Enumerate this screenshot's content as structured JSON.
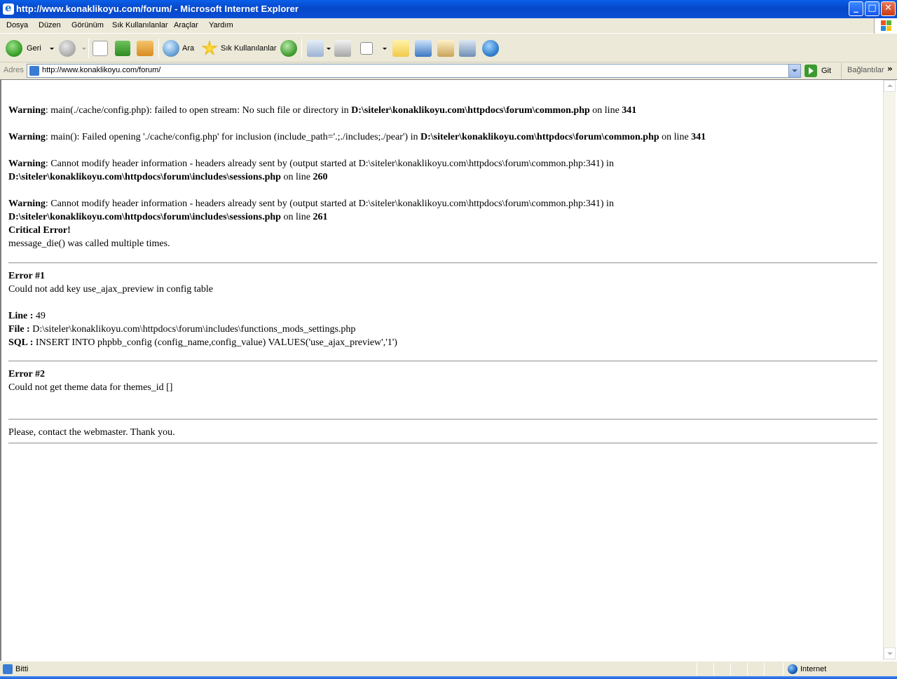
{
  "window": {
    "title": "http://www.konaklikoyu.com/forum/ - Microsoft Internet Explorer",
    "min_label": "_",
    "max_label": "□",
    "close_label": "✕"
  },
  "menu": {
    "items": [
      {
        "label": "Dosya"
      },
      {
        "label": "Düzen"
      },
      {
        "label": "Görünüm"
      },
      {
        "label": "Sık Kullanılanlar"
      },
      {
        "label": "Araçlar"
      },
      {
        "label": "Yardım"
      }
    ]
  },
  "toolbar": {
    "back_label": "Geri",
    "search_label": "Ara",
    "favorites_label": "Sık Kullanılanlar"
  },
  "address": {
    "label": "Adres",
    "url": "http://www.konaklikoyu.com/forum/",
    "go_label": "Git",
    "links_label": "Bağlantılar",
    "links_chevron": "»"
  },
  "page": {
    "warnings": [
      {
        "label": "Warning",
        "text": ": main(./cache/config.php): failed to open stream: No such file or directory in ",
        "path": "D:\\siteler\\konaklikoyu.com\\httpdocs\\forum\\common.php",
        "online": " on line ",
        "line": "341"
      },
      {
        "label": "Warning",
        "text": ": main(): Failed opening './cache/config.php' for inclusion (include_path='.;./includes;./pear') in ",
        "path": "D:\\siteler\\konaklikoyu.com\\httpdocs\\forum\\common.php",
        "online": " on line ",
        "line": "341"
      },
      {
        "label": "Warning",
        "text": ": Cannot modify header information - headers already sent by (output started at D:\\siteler\\konaklikoyu.com\\httpdocs\\forum\\common.php:341) in",
        "path": "D:\\siteler\\konaklikoyu.com\\httpdocs\\forum\\includes\\sessions.php",
        "online": " on line ",
        "line": "260"
      },
      {
        "label": "Warning",
        "text": ": Cannot modify header information - headers already sent by (output started at D:\\siteler\\konaklikoyu.com\\httpdocs\\forum\\common.php:341) in",
        "path": "D:\\siteler\\konaklikoyu.com\\httpdocs\\forum\\includes\\sessions.php",
        "online": " on line ",
        "line": "261"
      }
    ],
    "critical_title": "Critical Error!",
    "critical_message": "message_die() was called multiple times.",
    "error1": {
      "title": "Error #1",
      "message": "Could not add key use_ajax_preview in config table",
      "line_label": "Line :",
      "line_value": " 49",
      "file_label": "File :",
      "file_value": " D:\\siteler\\konaklikoyu.com\\httpdocs\\forum\\includes\\functions_mods_settings.php",
      "sql_label": "SQL :",
      "sql_value": " INSERT INTO phpbb_config (config_name,config_value) VALUES('use_ajax_preview','1')"
    },
    "error2": {
      "title": "Error #2",
      "message": "Could not get theme data for themes_id []"
    },
    "footer": "Please, contact the webmaster. Thank you."
  },
  "status": {
    "text": "Bitti",
    "zone": "Internet"
  }
}
